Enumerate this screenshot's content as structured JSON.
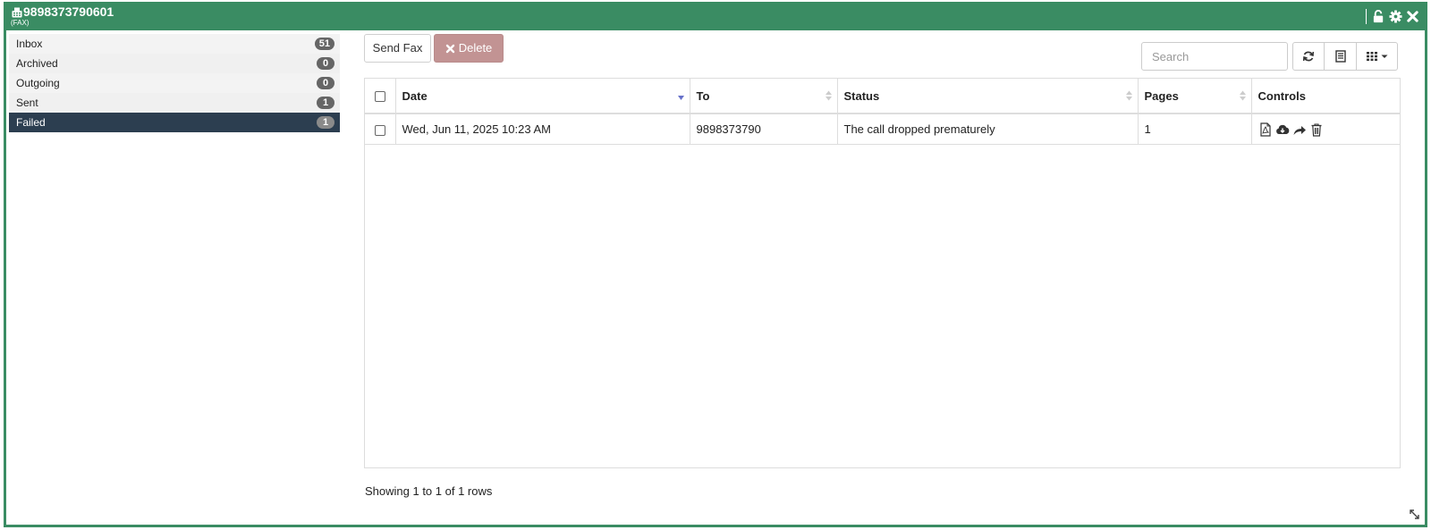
{
  "window": {
    "title_number": "9898373790601",
    "title_sub": "(FAX)",
    "icons": [
      "fax-icon",
      "unlock-icon",
      "gear-icon",
      "close-icon"
    ]
  },
  "folders": [
    {
      "label": "Inbox",
      "count": "51",
      "active": false
    },
    {
      "label": "Archived",
      "count": "0",
      "active": false
    },
    {
      "label": "Outgoing",
      "count": "0",
      "active": false
    },
    {
      "label": "Sent",
      "count": "1",
      "active": false
    },
    {
      "label": "Failed",
      "count": "1",
      "active": true
    }
  ],
  "toolbar": {
    "send_label": "Send Fax",
    "delete_label": "Delete",
    "search_placeholder": "Search",
    "icons": [
      "refresh-icon",
      "list-view-icon",
      "columns-icon"
    ]
  },
  "table": {
    "columns": [
      "Date",
      "To",
      "Status",
      "Pages",
      "Controls"
    ],
    "rows": [
      {
        "date": "Wed, Jun 11, 2025 10:23 AM",
        "to": "9898373790",
        "status": "The call dropped prematurely",
        "pages": "1"
      }
    ],
    "row_control_icons": [
      "pdf-icon",
      "cloud-download-icon",
      "forward-icon",
      "trash-icon"
    ]
  },
  "footer": {
    "pagination_text": "Showing 1 to 1 of 1 rows"
  },
  "colors": {
    "titlebar": "#3a8c63",
    "active_folder": "#2c3e50",
    "delete_button": "#c29393",
    "badge": "#666666"
  }
}
